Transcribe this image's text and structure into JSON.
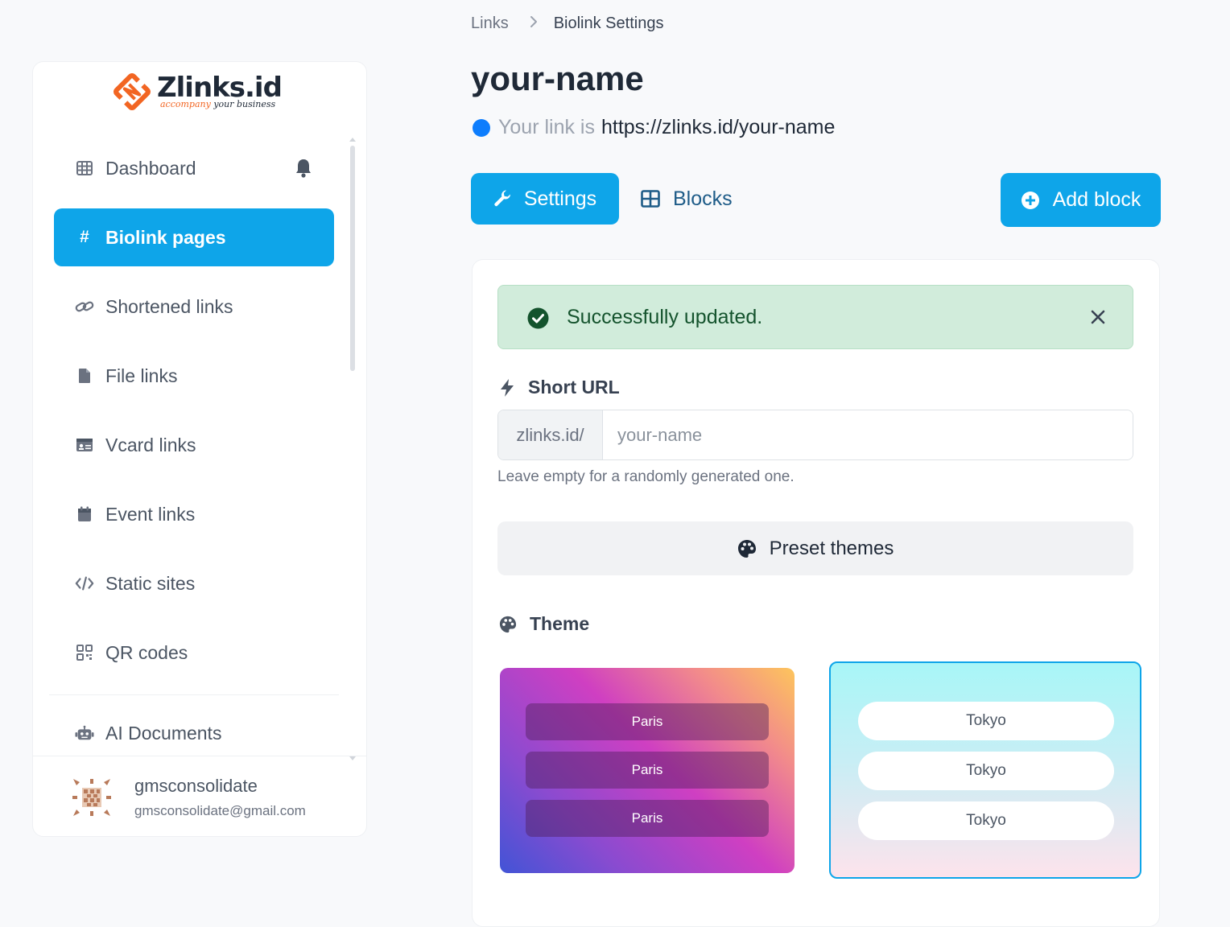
{
  "brand": {
    "name": "Zlinks.id",
    "tagline_part1": "accompany",
    "tagline_part2": "your business",
    "accent_color": "#f26522"
  },
  "sidebar": {
    "items": [
      {
        "label": "Dashboard",
        "icon": "table-icon"
      },
      {
        "label": "Biolink pages",
        "icon": "hashtag-icon",
        "active": true
      },
      {
        "label": "Shortened links",
        "icon": "link-icon"
      },
      {
        "label": "File links",
        "icon": "file-icon"
      },
      {
        "label": "Vcard links",
        "icon": "id-card-icon"
      },
      {
        "label": "Event links",
        "icon": "calendar-icon"
      },
      {
        "label": "Static sites",
        "icon": "code-icon"
      },
      {
        "label": "QR codes",
        "icon": "qrcode-icon"
      },
      {
        "label": "AI Documents",
        "icon": "robot-icon"
      }
    ],
    "notification_icon": "bell-icon"
  },
  "user": {
    "name": "gmsconsolidate",
    "email": "gmsconsolidate@gmail.com"
  },
  "breadcrumb": {
    "parent": "Links",
    "current": "Biolink Settings"
  },
  "page": {
    "title": "your-name",
    "link_label": "Your link is",
    "link_url": "https://zlinks.id/your-name"
  },
  "tabs": {
    "settings": "Settings",
    "blocks": "Blocks"
  },
  "actions": {
    "add_block": "Add block",
    "preset_themes": "Preset themes"
  },
  "alert": {
    "message": "Successfully updated.",
    "type": "success"
  },
  "short_url": {
    "label": "Short URL",
    "prefix": "zlinks.id/",
    "placeholder": "your-name",
    "value": "",
    "help": "Leave empty for a randomly generated one."
  },
  "theme": {
    "label": "Theme",
    "options": [
      {
        "name": "paris",
        "buttons": [
          "Paris",
          "Paris",
          "Paris"
        ],
        "selected": false
      },
      {
        "name": "tokyo",
        "buttons": [
          "Tokyo",
          "Tokyo",
          "Tokyo"
        ],
        "selected": true
      }
    ]
  },
  "colors": {
    "primary": "#0ea5e9",
    "success_bg": "#d1ecdb",
    "success_text": "#14532d",
    "status_dot": "#0d7dfd"
  }
}
